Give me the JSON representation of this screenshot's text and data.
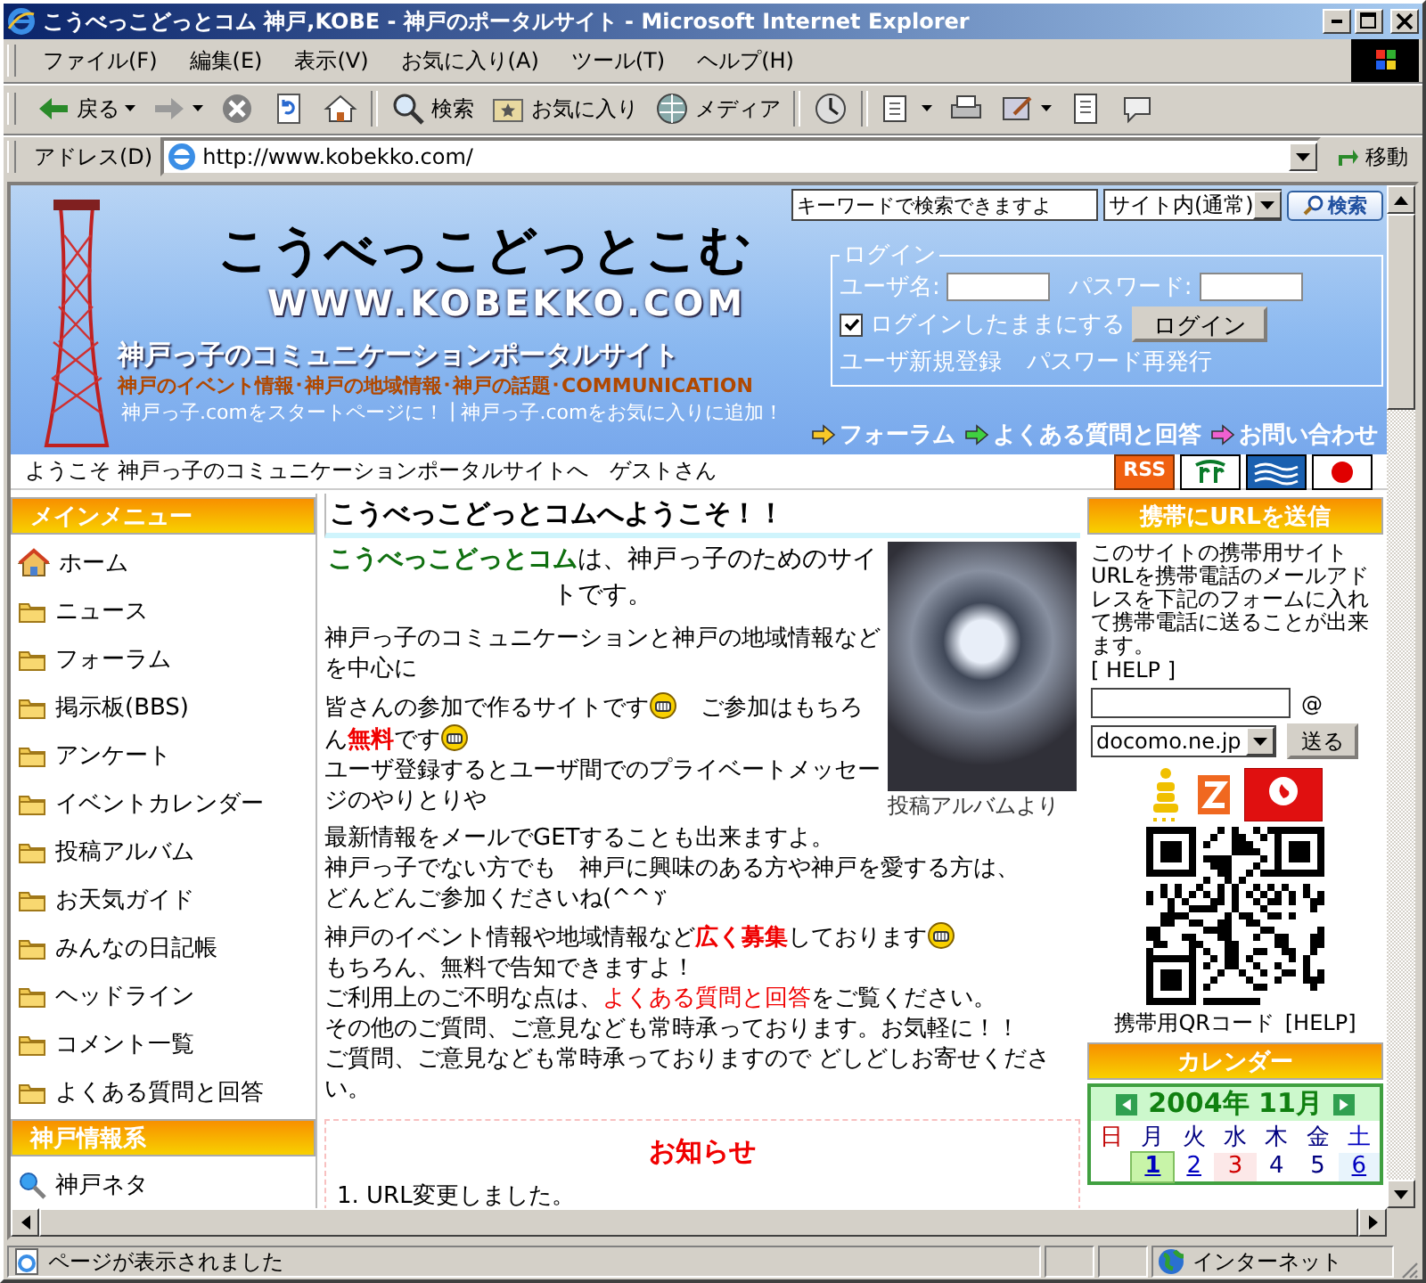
{
  "window": {
    "title": "こうべっこどっとコム 神戸,KOBE - 神戸のポータルサイト - Microsoft Internet Explorer"
  },
  "menu_bar": [
    "ファイル(F)",
    "編集(E)",
    "表示(V)",
    "お気に入り(A)",
    "ツール(T)",
    "ヘルプ(H)"
  ],
  "toolbar": [
    {
      "kind": "back",
      "label": "戻る",
      "has_menu": true
    },
    {
      "kind": "forward",
      "has_menu": true
    },
    {
      "kind": "stop",
      "has_menu": false
    },
    {
      "kind": "refresh",
      "has_menu": false
    },
    {
      "kind": "home",
      "has_menu": false
    },
    {
      "kind": "search",
      "label": "検索",
      "has_menu": false
    },
    {
      "kind": "favorites",
      "label": "お気に入り",
      "has_menu": false
    },
    {
      "kind": "media",
      "label": "メディア",
      "has_menu": false
    },
    {
      "kind": "history",
      "has_menu": false
    },
    {
      "kind": "mail",
      "has_menu": true
    },
    {
      "kind": "print",
      "has_menu": false
    },
    {
      "kind": "edit",
      "has_menu": true
    },
    {
      "kind": "discuss",
      "has_menu": false
    },
    {
      "kind": "messenger",
      "has_menu": false
    }
  ],
  "address_bar": {
    "label": "アドレス(D)",
    "url": "http://www.kobekko.com/",
    "go": "移動"
  },
  "site": {
    "search": {
      "value": "キーワードで検索できますよ",
      "scope": "サイト内(通常)",
      "button": "検索"
    },
    "logo": "こうべっこどっとこむ",
    "domain": "WWW.KOBEKKO.COM",
    "tagline": "神戸っ子のコミュニケーションポータルサイト",
    "subtagline": "神戸のイベント情報･神戸の地域情報･神戸の話題･COMMUNICATION",
    "links": [
      "神戸っ子.comをスタートページに！",
      "|",
      "神戸っ子.comをお気に入りに追加！"
    ],
    "login": {
      "legend": "ログイン",
      "user_label": "ユーザ名:",
      "password_label": "パスワード:",
      "remember": {
        "label": "ログインしたままにする",
        "checked": true
      },
      "button": "ログイン",
      "links": [
        "ユーザ新規登録",
        "パスワード再発行"
      ]
    },
    "nav": [
      {
        "label": "フォーラム",
        "color": "#f8c828"
      },
      {
        "label": "よくある質問と回答",
        "color": "#40d040"
      },
      {
        "label": "お問い合わせ",
        "color": "#f060d0"
      }
    ],
    "welcome": "ようこそ 神戸っ子のコミュニケーションポータルサイトへ　ゲストさん",
    "badges": [
      {
        "kind": "rss",
        "label": "RSS"
      },
      {
        "kind": "emblem"
      },
      {
        "kind": "wave"
      },
      {
        "kind": "flag"
      }
    ]
  },
  "main_menu": {
    "title": "メインメニュー",
    "items": [
      {
        "kind": "home",
        "label": "ホーム"
      },
      {
        "kind": "folder",
        "label": "ニュース"
      },
      {
        "kind": "folder",
        "label": "フォーラム"
      },
      {
        "kind": "folder",
        "label": "掲示板(BBS)"
      },
      {
        "kind": "folder",
        "label": "アンケート"
      },
      {
        "kind": "folder",
        "label": "イベントカレンダー"
      },
      {
        "kind": "folder",
        "label": "投稿アルバム"
      },
      {
        "kind": "folder",
        "label": "お天気ガイド"
      },
      {
        "kind": "folder",
        "label": "みんなの日記帳"
      },
      {
        "kind": "folder",
        "label": "ヘッドライン"
      },
      {
        "kind": "folder",
        "label": "コメント一覧"
      },
      {
        "kind": "folder",
        "label": "よくある質問と回答"
      }
    ]
  },
  "kobe_info": {
    "title": "神戸情報系",
    "items": [
      {
        "kind": "search",
        "label": "神戸ネタ"
      }
    ]
  },
  "content": {
    "title": "こうべっこどっとコムへようこそ！！",
    "intro_highlight": "こうべっこどっとコム",
    "intro": "は、神戸っ子のためのサイトです。",
    "photo_caption": "投稿アルバムより",
    "paragraphs": [
      [
        [
          {
            "kind": "plain",
            "text": "神戸っ子のコミュニケーションと神戸の地域情報などを中心に"
          }
        ]
      ],
      [
        [
          {
            "kind": "plain",
            "text": "皆さんの参加で作るサイトです"
          },
          {
            "kind": "smiley"
          },
          {
            "kind": "plain",
            "text": "　ご参加はもちろん"
          },
          {
            "kind": "strong",
            "text": "無料"
          },
          {
            "kind": "plain",
            "text": "です"
          },
          {
            "kind": "smiley"
          }
        ],
        [
          {
            "kind": "plain",
            "text": "ユーザ登録するとユーザ間でのプライベートメッセージのやりとりや"
          }
        ]
      ],
      [
        [
          {
            "kind": "plain",
            "text": "最新情報をメールでGETすることも出来ますよ。"
          }
        ],
        [
          {
            "kind": "plain",
            "text": "神戸っ子でない方でも　神戸に興味のある方や神戸を愛する方は、"
          }
        ],
        [
          {
            "kind": "plain",
            "text": "どんどんご参加くださいね(^^"
          },
          {
            "kind": "iteration-mark"
          }
        ]
      ],
      [
        [
          {
            "kind": "plain",
            "text": "神戸のイベント情報や地域情報など"
          },
          {
            "kind": "strong",
            "text": "広く募集"
          },
          {
            "kind": "plain",
            "text": "しております"
          },
          {
            "kind": "smiley"
          }
        ],
        [
          {
            "kind": "plain",
            "text": "もちろん、無料で告知できますよ！"
          }
        ],
        [
          {
            "kind": "plain",
            "text": "ご利用上のご不明な点は、"
          },
          {
            "kind": "link",
            "text": "よくある質問と回答"
          },
          {
            "kind": "plain",
            "text": "をご覧ください。"
          }
        ],
        [
          {
            "kind": "plain",
            "text": "その他のご質問、ご意見なども常時承っております。お気軽に！！"
          }
        ],
        [
          {
            "kind": "plain",
            "text": "ご質問、ご意見なども常時承っておりますので どしどしお寄せください。"
          }
        ]
      ]
    ],
    "notice": {
      "title": "お知らせ",
      "items": [
        "1. URL変更しました。"
      ]
    }
  },
  "mobile": {
    "title": "携帯にURLを送信",
    "description": "このサイトの携帯用サイトURLを携帯電話のメールアドレスを下記のフォームに入れて携帯電話に送ることが出来ます。",
    "help": "[ HELP ]",
    "at": "@",
    "domain": "docomo.ne.jp",
    "button": "送る",
    "qr_caption": "携帯用QRコード",
    "qr_help": "[HELP]"
  },
  "calendar": {
    "title": "カレンダー",
    "month": "2004年 11月",
    "weekdays": [
      {
        "kind": "sunday",
        "label": "日"
      },
      {
        "kind": "weekday",
        "label": "月"
      },
      {
        "kind": "weekday",
        "label": "火"
      },
      {
        "kind": "weekday",
        "label": "水"
      },
      {
        "kind": "weekday",
        "label": "木"
      },
      {
        "kind": "weekday",
        "label": "金"
      },
      {
        "kind": "saturday",
        "label": "土"
      }
    ],
    "days": [
      {
        "kind": "blank"
      },
      {
        "kind": "weekday",
        "label": "1",
        "selected": true,
        "link": true
      },
      {
        "kind": "weekday",
        "label": "2",
        "selected": false,
        "link": true
      },
      {
        "kind": "holiday",
        "label": "3",
        "selected": false,
        "link": false
      },
      {
        "kind": "weekday",
        "label": "4",
        "selected": false,
        "link": false
      },
      {
        "kind": "weekday",
        "label": "5",
        "selected": false,
        "link": false
      },
      {
        "kind": "saturday",
        "label": "6",
        "selected": false,
        "link": true
      }
    ]
  },
  "status_bar": {
    "text": "ページが表示されました",
    "zone": "インターネット"
  }
}
